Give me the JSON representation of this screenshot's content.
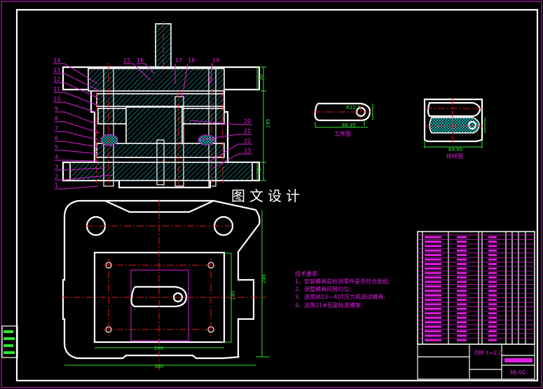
{
  "drawing": {
    "watermark": "图文设计",
    "part_labels_left": [
      "14",
      "13",
      "12",
      "11",
      "10",
      "9",
      "8",
      "7",
      "6",
      "5",
      "4",
      "3",
      "2",
      "1"
    ],
    "part_labels_top": [
      "15",
      "16",
      "17",
      "18",
      "19"
    ],
    "part_labels_right": [
      "20",
      "21",
      "22",
      "23"
    ],
    "section_dims": {
      "top": "30",
      "height": "195",
      "bottom": "40"
    },
    "plan_dims": {
      "height": "246",
      "inner_height": "140",
      "inner_width": "200",
      "width": "300"
    },
    "process_view": {
      "title": "工序图",
      "dim_radius": "R12.5",
      "dim_length": "66.95"
    },
    "layout_view": {
      "title": "排样图",
      "dim_length": "69.95"
    },
    "tech_requirements": {
      "title": "技术要求:",
      "items": [
        "1、安装模具前检测零件是否符合图纸;",
        "2、调整模具间隙均匀;",
        "3、选用JB23—40T压力机调试模具;",
        "4、选用21#层副标准模架;"
      ]
    },
    "title_block": {
      "material": "08F t=2.0",
      "drawing_no": "MJ-00"
    }
  },
  "colors": {
    "outline": "#ffffff",
    "center": "#e01818",
    "dimension": "#2ee62e",
    "annotation": "#e01ee0",
    "hatch": "#22d0d0"
  }
}
